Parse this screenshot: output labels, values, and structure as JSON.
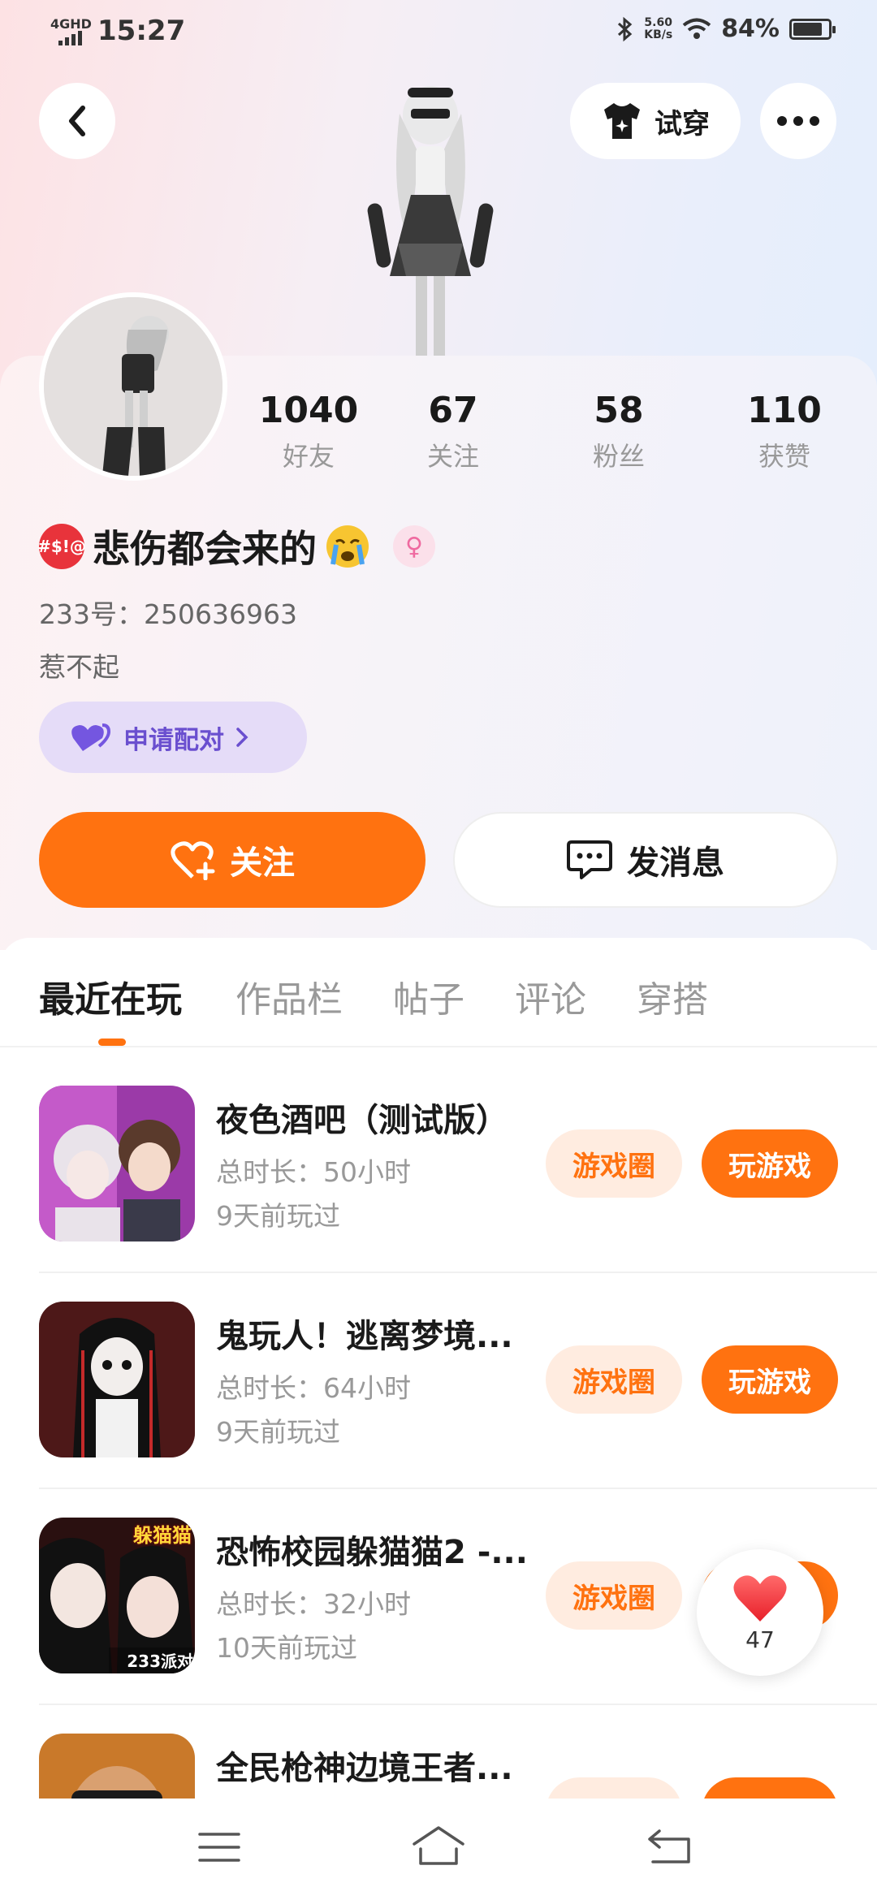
{
  "status_bar": {
    "network": "4GHD",
    "time": "15:27",
    "speed": "5.60",
    "speed_unit": "KB/s",
    "battery": "84%",
    "battery_level": 0.84
  },
  "header": {
    "try_on_label": "试穿"
  },
  "stats": [
    {
      "num": "1040",
      "label": "好友"
    },
    {
      "num": "67",
      "label": "关注"
    },
    {
      "num": "58",
      "label": "粉丝"
    },
    {
      "num": "110",
      "label": "获赞"
    }
  ],
  "profile": {
    "emoji_left_text": "#$!@",
    "name": "悲伤都会来的",
    "gender_symbol": "♀",
    "uid": "233号：250636963",
    "bio": "惹不起",
    "pair_label": "申请配对"
  },
  "actions": {
    "follow": "关注",
    "message": "发消息"
  },
  "tabs": [
    "最近在玩",
    "作品栏",
    "帖子",
    "评论",
    "穿搭"
  ],
  "games": [
    {
      "title": "夜色酒吧（测试版）",
      "duration": "总时长：50小时",
      "last": "9天前玩过",
      "circle": "游戏圈",
      "play": "玩游戏"
    },
    {
      "title": "鬼玩人！逃离梦境...",
      "duration": "总时长：64小时",
      "last": "9天前玩过",
      "circle": "游戏圈",
      "play": "玩游戏"
    },
    {
      "title": "恐怖校园躲猫猫2 -...",
      "duration": "总时长：32小时",
      "last": "10天前玩过",
      "circle": "游戏圈",
      "play": "玩游戏",
      "icon_badge_top": "躲猫猫",
      "icon_badge_bottom": "233派对"
    },
    {
      "title": "全民枪神边境王者...",
      "duration": "",
      "last": "",
      "circle": "",
      "play": ""
    }
  ],
  "like_float": {
    "count": "47"
  },
  "colors": {
    "accent": "#ff7210",
    "accent_light": "#ffece0",
    "pair_bg": "#e5dcf8",
    "pair_text": "#6a4fcf"
  }
}
